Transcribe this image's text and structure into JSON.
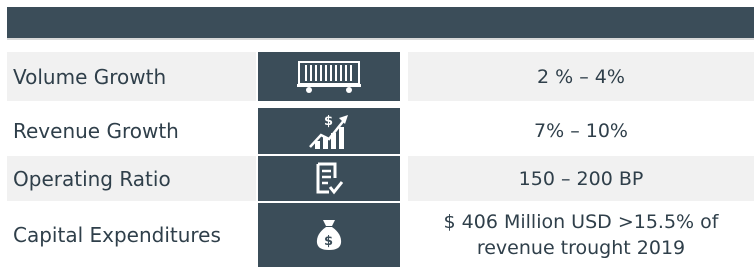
{
  "header": {
    "title": ""
  },
  "rows": [
    {
      "label": "Volume Growth",
      "icon": "rail-car-icon",
      "value": "2 % – 4%"
    },
    {
      "label": "Revenue Growth",
      "icon": "revenue-growth-chart-icon",
      "value": "7% – 10%"
    },
    {
      "label": "Operating Ratio",
      "icon": "checklist-document-icon",
      "value": "150 – 200 BP"
    },
    {
      "label": "Capital Expenditures",
      "icon": "money-bag-icon",
      "value": "$ 406 Million USD >15.5% of\nrevenue trought 2019"
    }
  ],
  "colors": {
    "header": "#3b4d59",
    "icon_column": "#3b4d59",
    "row_light": "#f1f1f1",
    "text": "#2f3f4a"
  }
}
